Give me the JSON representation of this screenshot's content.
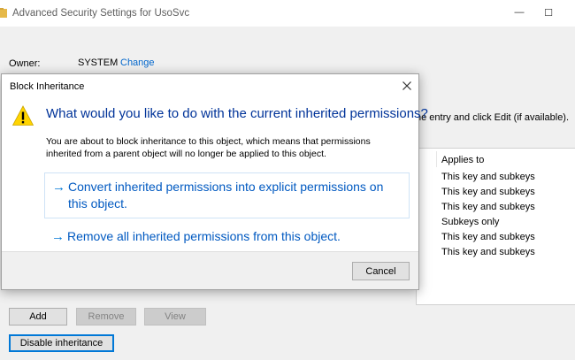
{
  "window": {
    "title": "Advanced Security Settings for UsoSvc",
    "minimize_glyph": "—",
    "maximize_glyph": "☐"
  },
  "owner": {
    "label": "Owner:",
    "value": "SYSTEM",
    "change_link": "Change"
  },
  "hint": "he entry and click Edit (if available).",
  "permissions": {
    "header": "Applies to",
    "rows": [
      "This key and subkeys",
      "This key and subkeys",
      "This key and subkeys",
      "Subkeys only",
      "This key and subkeys",
      "This key and subkeys"
    ]
  },
  "buttons": {
    "add": "Add",
    "remove": "Remove",
    "view": "View",
    "disable_inheritance": "Disable inheritance"
  },
  "dialog": {
    "title": "Block Inheritance",
    "heading": "What would you like to do with the current inherited permissions?",
    "body_line1": "You are about to block inheritance to this object, which means that permissions",
    "body_line2": "inherited from a parent object will no longer be applied to this object.",
    "option1_line1": "Convert inherited permissions into explicit permissions on",
    "option1_line2": "this object.",
    "option2": "Remove all inherited permissions from this object.",
    "cancel": "Cancel"
  },
  "colors": {
    "accent": "#0078d7",
    "link": "#0066cc",
    "heading": "#003399",
    "warning_yellow": "#ffd400"
  },
  "icons": [
    "folder-icon",
    "minimize-icon",
    "maximize-icon",
    "close-icon",
    "warning-icon",
    "arrow-right-icon"
  ]
}
